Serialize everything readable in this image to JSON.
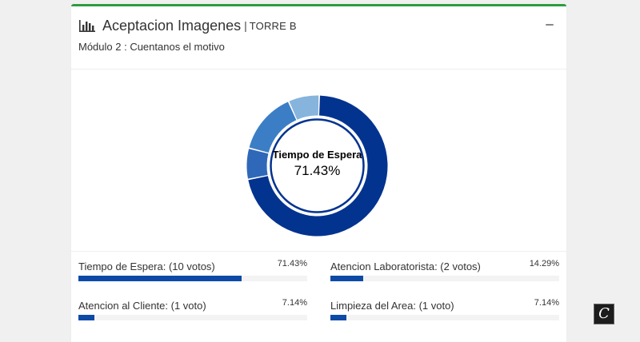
{
  "header": {
    "title": "Aceptacion Imagenes",
    "separator": "|",
    "subtitle": "TORRE B",
    "module": "Módulo 2 : Cuentanos el motivo",
    "accent_color": "#2e9c3f",
    "icon": "bar-chart-icon"
  },
  "chart_data": {
    "type": "pie",
    "variant": "donut",
    "center_label": "Tiempo de Espera",
    "center_value": "71.43%",
    "categories": [
      "Tiempo de Espera",
      "Atencion Laboratorista",
      "Atencion al Cliente",
      "Limpieza del Area"
    ],
    "values": [
      10,
      2,
      1,
      1
    ],
    "percentages": [
      71.43,
      14.29,
      7.14,
      7.14
    ],
    "colors": [
      "#02338f",
      "#3c7ec6",
      "#86b4dc",
      "#2f68b8"
    ],
    "order_drawn": [
      0,
      3,
      1,
      2
    ]
  },
  "stats": [
    {
      "label": "Tiempo de Espera: (10 votos)",
      "pct_text": "71.43%",
      "pct": 71.43
    },
    {
      "label": "Atencion Laboratorista: (2 votos)",
      "pct_text": "14.29%",
      "pct": 14.29
    },
    {
      "label": "Atencion al Cliente: (1 voto)",
      "pct_text": "7.14%",
      "pct": 7.14
    },
    {
      "label": "Limpieza del Area: (1 voto)",
      "pct_text": "7.14%",
      "pct": 7.14
    }
  ],
  "watermark": {
    "letter": "C",
    "icon": "c-logo-icon"
  }
}
